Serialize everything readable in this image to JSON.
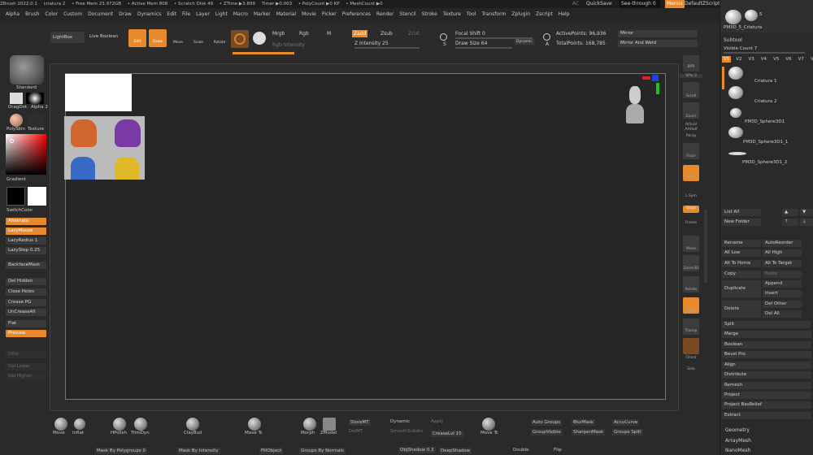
{
  "titlebar": {
    "app": "ZBrush 2022.0.1",
    "doc": "criatura 2",
    "stats": [
      "• Free Mem 23.972GB",
      "• Active Mem 808",
      "• Scratch Disk 49",
      "• ZTime ▶3.899",
      "Timer ▶0.003",
      "• PolyCount ▶0 KP",
      "• MeshCount ▶0"
    ],
    "ac": "AC",
    "quicksave": "QuickSave",
    "seethrough": "See-through  0",
    "menus": "Menus",
    "default_script": "DefaultZScript"
  },
  "menubar": [
    "Alpha",
    "Brush",
    "Color",
    "Custom",
    "Document",
    "Draw",
    "Dynamics",
    "Edit",
    "File",
    "Layer",
    "Light",
    "Macro",
    "Marker",
    "Material",
    "Movie",
    "Picker",
    "Preferences",
    "Render",
    "Stencil",
    "Stroke",
    "Texture",
    "Tool",
    "Transform",
    "Zplugin",
    "Zscript",
    "Help"
  ],
  "shelf": {
    "lightbox": "LightBox",
    "live_boolean": "Live Boolean",
    "edit": "Edit",
    "draw": "Draw",
    "move": "Move",
    "scale": "Scale",
    "rotate": "Rotate",
    "mrgb": "Mrgb",
    "rgb": "Rgb",
    "m": "M",
    "rgb_intensity": "Rgb Intensity",
    "zadd": "Zadd",
    "zsub": "Zsub",
    "zcut": "Zcut",
    "z_intensity": "Z Intensity 25",
    "focal_shift": "Focal Shift 0",
    "draw_size": "Draw Size 64",
    "dynamic": "Dynamic",
    "active_points": "ActivePoints: 96,936",
    "total_points": "TotalPoints: 168,785",
    "mirror": "Mirror",
    "mirror_weld": "Mirror And Weld",
    "s_label": "S",
    "a_label": "A"
  },
  "left": {
    "brush": "Standard",
    "dragdot": "DragDot",
    "alpha": "Alpha 2",
    "polyskin": "PolySkin",
    "texture": "Texture",
    "gradient": "Gradient",
    "switchcolor": "SwitchColor",
    "alternate": "Alternate",
    "lazymouse": "LazyMouse",
    "lazyradius": "LazyRadius 1",
    "lazystep": "LazyStep 0.25",
    "backfacemask": "BackfaceMask",
    "del_hidden": "Del Hidden",
    "close_holes": "Close Holes",
    "crease_pg": "Crease PG",
    "uncrease_all": "UnCreaseAll",
    "flat": "Flat",
    "preview": "Preview",
    "ddiv": "DDiv",
    "del_lower": "Del Lower",
    "del_higher": "Del Higher"
  },
  "right_tools": {
    "bpr": "BPR",
    "spix": "SPix 3",
    "scroll": "Scroll",
    "zoom": "Zoom",
    "actual": "Actual",
    "aahalf": "AAHalf",
    "persp": "Persp",
    "floor": "Floor",
    "local": "Local",
    "lsym": "L.Sym",
    "gxyz": "Gxyz",
    "frame": "Frame",
    "move": "Move",
    "zoom3d": "Zoom3D",
    "rotate": "Rotate",
    "polyf": "PolyF",
    "transp": "Transp",
    "ghost": "Ghost",
    "solo": "Solo",
    "dynamic": "Dynamic"
  },
  "subtool": {
    "top_item": "PM3D_5_Criatura",
    "top_num": "5",
    "header": "Subtool",
    "visible_count": "Visible Count 7",
    "versions": [
      "V1",
      "V2",
      "V3",
      "V4",
      "V5",
      "V6",
      "V7",
      "V8"
    ],
    "items": [
      "Criatura 1",
      "Criatura 2",
      "PM3D_Sphere3D1",
      "PM3D_Sphere3D1_1",
      "PM3D_Sphere3D1_2"
    ],
    "list_all": "List All",
    "new_folder": "New Folder",
    "rename": "Rename",
    "autoreorder": "AutoReorder",
    "all_low": "All Low",
    "all_high": "All High",
    "all_to_home": "All To Home",
    "all_to_target": "All To Target",
    "copy": "Copy",
    "paste": "Paste",
    "duplicate": "Duplicate",
    "append": "Append",
    "insert": "Insert",
    "delete": "Delete",
    "del_other": "Del Other",
    "del_all": "Del All",
    "split": "Split",
    "merge": "Merge",
    "boolean": "Boolean",
    "bevel_pro": "Bevel Pro",
    "align": "Align",
    "distribute": "Distribute",
    "remesh": "Remesh",
    "project": "Project",
    "project_basrelief": "Project BasRelief",
    "extract": "Extract",
    "geometry": "Geometry",
    "arraymesh": "ArrayMesh",
    "nanomesh": "NanoMesh"
  },
  "bottom": {
    "move": "Move",
    "inflat": "Inflat",
    "hpolish": "HPolish",
    "trimdyn": "TrimDyn",
    "claybuild": "ClayBuil",
    "movetc": "Move Tc",
    "morph": "Morph",
    "zmodel": "ZModel",
    "storemt": "StoreMT",
    "delmt": "DelMT",
    "dynamic": "Dynamic",
    "apply": "Apply",
    "smoothsubdiv": "SmoothSubdiv",
    "creaselvl": "CreaseLvl 15",
    "movetc2": "Move Tc",
    "auto_groups": "Auto Groups",
    "groupvisible": "GroupVisible",
    "blurmask": "BlurMask",
    "sharpenmask": "SharpenMask",
    "accucurve": "AccuCurve",
    "groups_split": "Groups Split",
    "mask_by_polygroups": "Mask By Polygroups 0",
    "mask_by_intensity": "Mask By Intensity",
    "fillobject": "FillObject",
    "groups_by_normals": "Groups By Normals",
    "objshadow": "ObjShadow 0.3",
    "deepshadow": "DeepShadow",
    "double": "Double",
    "flip": "Flip"
  },
  "colors": {
    "accent": "#e8892d",
    "bg": "#2a2a2a"
  }
}
